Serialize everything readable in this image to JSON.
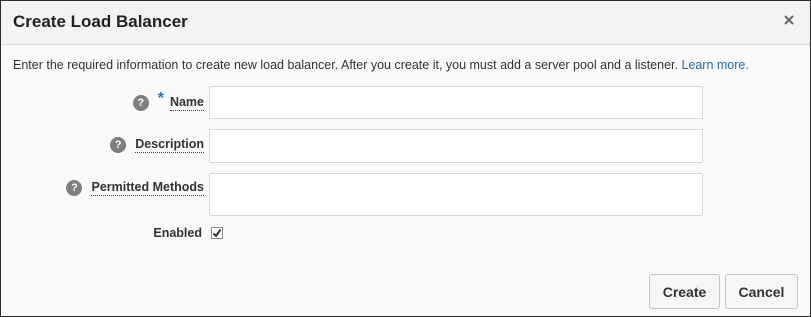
{
  "dialog": {
    "title": "Create Load Balancer",
    "close_icon": "close-icon",
    "intro_text": "Enter the required information to create new load balancer. After you create it, you must add a server pool and a listener. ",
    "learn_more": "Learn more."
  },
  "form": {
    "name": {
      "label": "Name",
      "required_marker": "*",
      "value": "",
      "help": "?"
    },
    "description": {
      "label": "Description",
      "value": "",
      "help": "?"
    },
    "permitted_methods": {
      "label": "Permitted Methods",
      "value": "",
      "help": "?"
    },
    "enabled": {
      "label": "Enabled",
      "checked": true
    }
  },
  "buttons": {
    "create": "Create",
    "cancel": "Cancel"
  },
  "colors": {
    "link": "#1f6aa8",
    "required": "#1a73c9",
    "help_icon_bg": "#7e7e7e"
  }
}
